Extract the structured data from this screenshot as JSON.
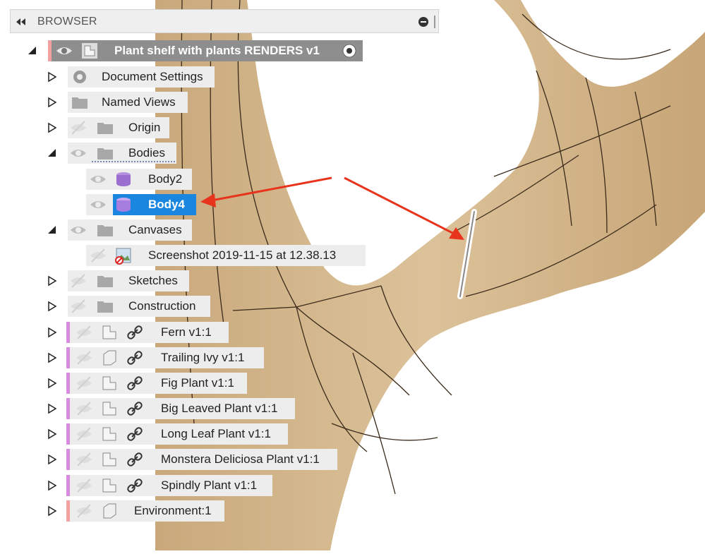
{
  "panel": {
    "title": "BROWSER"
  },
  "root": {
    "label": "Plant shelf with plants RENDERS v1"
  },
  "nodes": {
    "document_settings": "Document Settings",
    "named_views": "Named Views",
    "origin": "Origin",
    "bodies": "Bodies",
    "body2": "Body2",
    "body4": "Body4",
    "canvases": "Canvases",
    "screenshot": "Screenshot 2019-11-15 at 12.38.13",
    "sketches": "Sketches",
    "construction": "Construction",
    "fern": "Fern v1:1",
    "trailing_ivy": "Trailing Ivy v1:1",
    "fig_plant": "Fig Plant v1:1",
    "big_leaved": "Big Leaved Plant v1:1",
    "long_leaf": "Long Leaf Plant v1:1",
    "monstera": "Monstera Deliciosa Plant v1:1",
    "spindly": "Spindly Plant v1:1",
    "environment": "Environment:1"
  },
  "colors": {
    "wood": "#d2b48c",
    "selection": "#1a86e0",
    "annotation_arrow": "#e8341c",
    "component_stripe": "#d98be0",
    "root_stripe": "#f2a0a0"
  }
}
